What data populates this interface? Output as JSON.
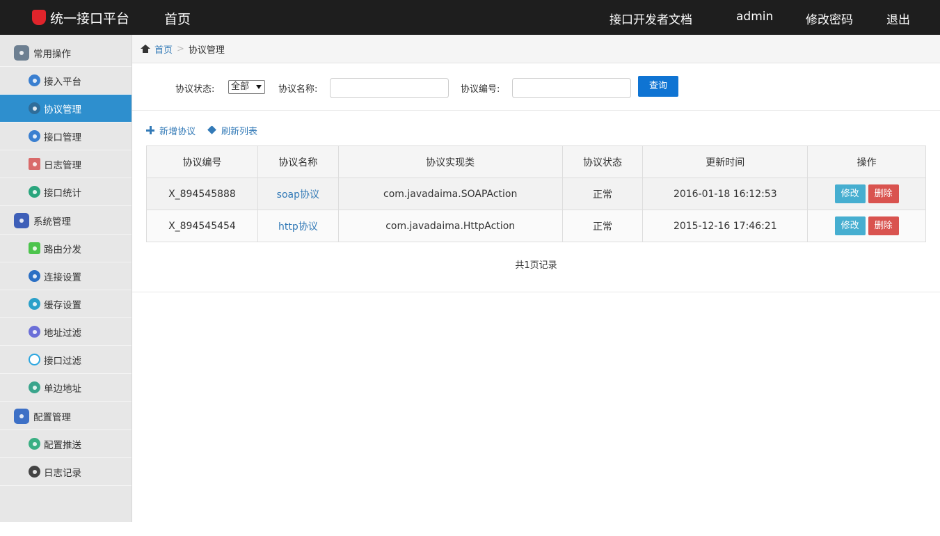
{
  "header": {
    "brand": "统一接口平台",
    "home": "首页",
    "docs": "接口开发者文档",
    "user": "admin",
    "change_password": "修改密码",
    "logout": "退出"
  },
  "sidebar": {
    "groups": [
      {
        "label": "常用操作",
        "icon": "gear-icon",
        "color": "#6d7f91",
        "items": [
          {
            "label": "接入平台",
            "icon": "accessibility-icon",
            "color": "#3a7fd0"
          },
          {
            "label": "协议管理",
            "icon": "network-icon",
            "color": "#2f6d9a",
            "active": true
          },
          {
            "label": "接口管理",
            "icon": "transfer-icon",
            "color": "#3a7fd0"
          },
          {
            "label": "日志管理",
            "icon": "chart-icon",
            "color": "#d96a6a"
          },
          {
            "label": "接口统计",
            "icon": "leaf-icon",
            "color": "#2aa57d"
          }
        ]
      },
      {
        "label": "系统管理",
        "icon": "settings-icon",
        "color": "#3e5fb8",
        "items": [
          {
            "label": "路由分发",
            "icon": "route-icon",
            "color": "#4cc44c"
          },
          {
            "label": "连接设置",
            "icon": "connect-icon",
            "color": "#2b6fc4"
          },
          {
            "label": "缓存设置",
            "icon": "cache-icon",
            "color": "#2aa0c9"
          },
          {
            "label": "地址过滤",
            "icon": "address-filter-icon",
            "color": "#6b6fd8"
          },
          {
            "label": "接口过滤",
            "icon": "interface-filter-icon",
            "color": "#2ba6e0"
          },
          {
            "label": "单边地址",
            "icon": "monitor-icon",
            "color": "#3aa58c"
          }
        ]
      },
      {
        "label": "配置管理",
        "icon": "pulse-icon",
        "color": "#3d70c6",
        "items": [
          {
            "label": "配置推送",
            "icon": "push-icon",
            "color": "#3aaf83"
          },
          {
            "label": "日志记录",
            "icon": "record-icon",
            "color": "#444444"
          }
        ]
      }
    ]
  },
  "breadcrumb": {
    "home": "首页",
    "current": "协议管理"
  },
  "filter": {
    "status_label": "协议状态:",
    "status_value": "全部",
    "name_label": "协议名称:",
    "name_value": "",
    "code_label": "协议编号:",
    "code_value": "",
    "query_button": "查询"
  },
  "toolbar": {
    "add": "新增协议",
    "refresh": "刷新列表"
  },
  "table": {
    "headers": [
      "协议编号",
      "协议名称",
      "协议实现类",
      "协议状态",
      "更新时间",
      "操作"
    ],
    "rows": [
      {
        "code": "X_894545888",
        "name": "soap协议",
        "impl": "com.javadaima.SOAPAction",
        "status": "正常",
        "updated": "2016-01-18 16:12:53",
        "edit": "修改",
        "delete": "删除"
      },
      {
        "code": "X_894545454",
        "name": "http协议",
        "impl": "com.javadaima.HttpAction",
        "status": "正常",
        "updated": "2015-12-16 17:46:21",
        "edit": "修改",
        "delete": "删除"
      }
    ]
  },
  "pager": {
    "text": "共1页记录"
  }
}
